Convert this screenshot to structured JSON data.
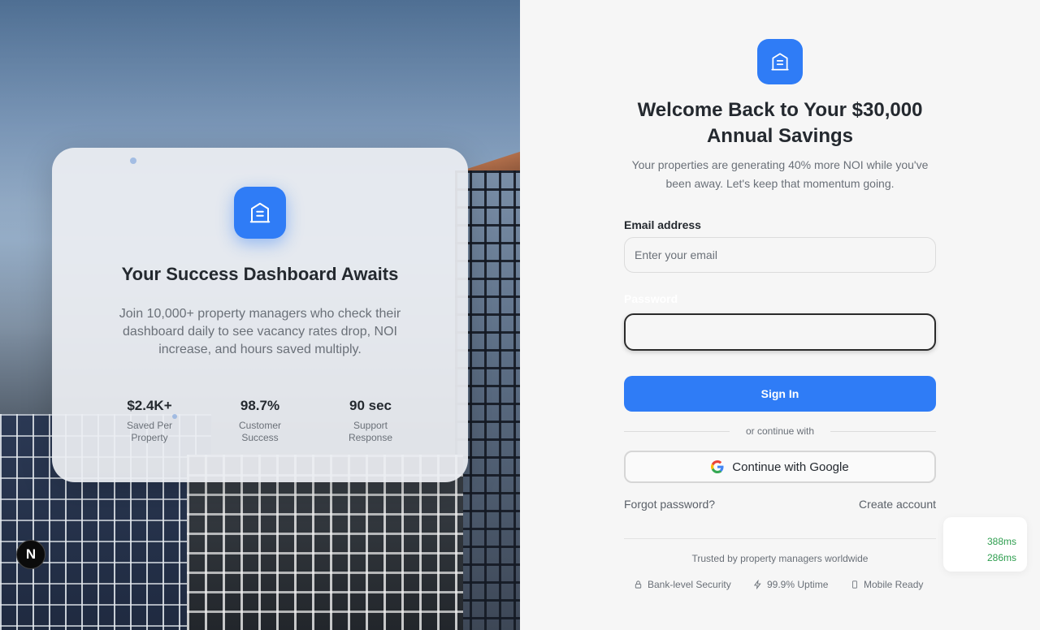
{
  "hero": {
    "card": {
      "title": "Your Success Dashboard Awaits",
      "description": "Join 10,000+ property managers who check their dashboard daily to see vacancy rates drop, NOI increase, and hours saved multiply.",
      "stats": [
        {
          "value": "$2.4K+",
          "label": "Saved Per Property"
        },
        {
          "value": "98.7%",
          "label": "Customer Success"
        },
        {
          "value": "90 sec",
          "label": "Support Response"
        }
      ]
    },
    "badge": "N"
  },
  "form": {
    "headline": "Welcome Back to Your $30,000 Annual Savings",
    "subline": "Your properties are generating 40% more NOI while you've been away. Let's keep that momentum going.",
    "email_label": "Email address",
    "email_placeholder": "Enter your email",
    "password_label": "Password",
    "signin_label": "Sign In",
    "divider_text": "or continue with",
    "google_label": "Continue with Google",
    "forgot_label": "Forgot password?",
    "create_label": "Create account",
    "trusted_text": "Trusted by property managers worldwide",
    "features": [
      {
        "icon": "lock-icon",
        "label": "Bank-level Security"
      },
      {
        "icon": "lightning-icon",
        "label": "99.9% Uptime"
      },
      {
        "icon": "phone-icon",
        "label": "Mobile Ready"
      }
    ]
  },
  "perf": {
    "values": [
      "388ms",
      "286ms"
    ]
  },
  "colors": {
    "primary": "#2f7cf6",
    "perf_green": "#2e9e4f"
  }
}
